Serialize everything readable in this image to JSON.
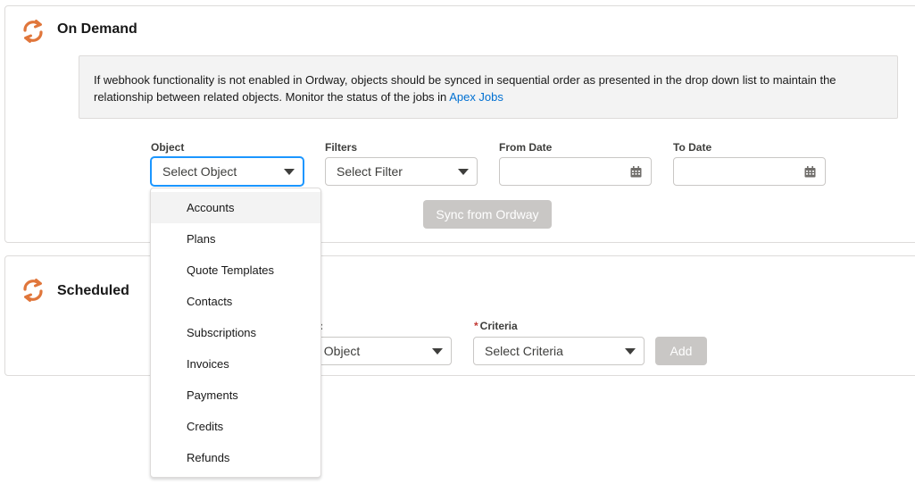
{
  "on_demand": {
    "title": "On Demand",
    "info_text": "If webhook functionality is not enabled in Ordway, objects should be synced in sequential order as presented in the drop down list to maintain the relationship between related objects. Monitor the status of the jobs in ",
    "info_link": "Apex Jobs",
    "object_label": "Object",
    "object_placeholder": "Select Object",
    "filters_label": "Filters",
    "filter_placeholder": "Select Filter",
    "from_date_label": "From Date",
    "to_date_label": "To Date",
    "sync_button": "Sync from Ordway"
  },
  "object_dropdown": {
    "options": [
      "Accounts",
      "Plans",
      "Quote Templates",
      "Contacts",
      "Subscriptions",
      "Invoices",
      "Payments",
      "Credits",
      "Refunds"
    ]
  },
  "scheduled": {
    "title": "Scheduled",
    "object_label_partial": ":",
    "object_placeholder_partial": "t Object",
    "criteria_required": "*",
    "criteria_label": "Criteria",
    "criteria_placeholder": "Select Criteria",
    "add_button": "Add"
  },
  "colors": {
    "accent_icon": "#e0763b",
    "link": "#0070d2",
    "disabled_button": "#c9c7c5",
    "required": "#c23934",
    "focus": "#1b96ff"
  }
}
